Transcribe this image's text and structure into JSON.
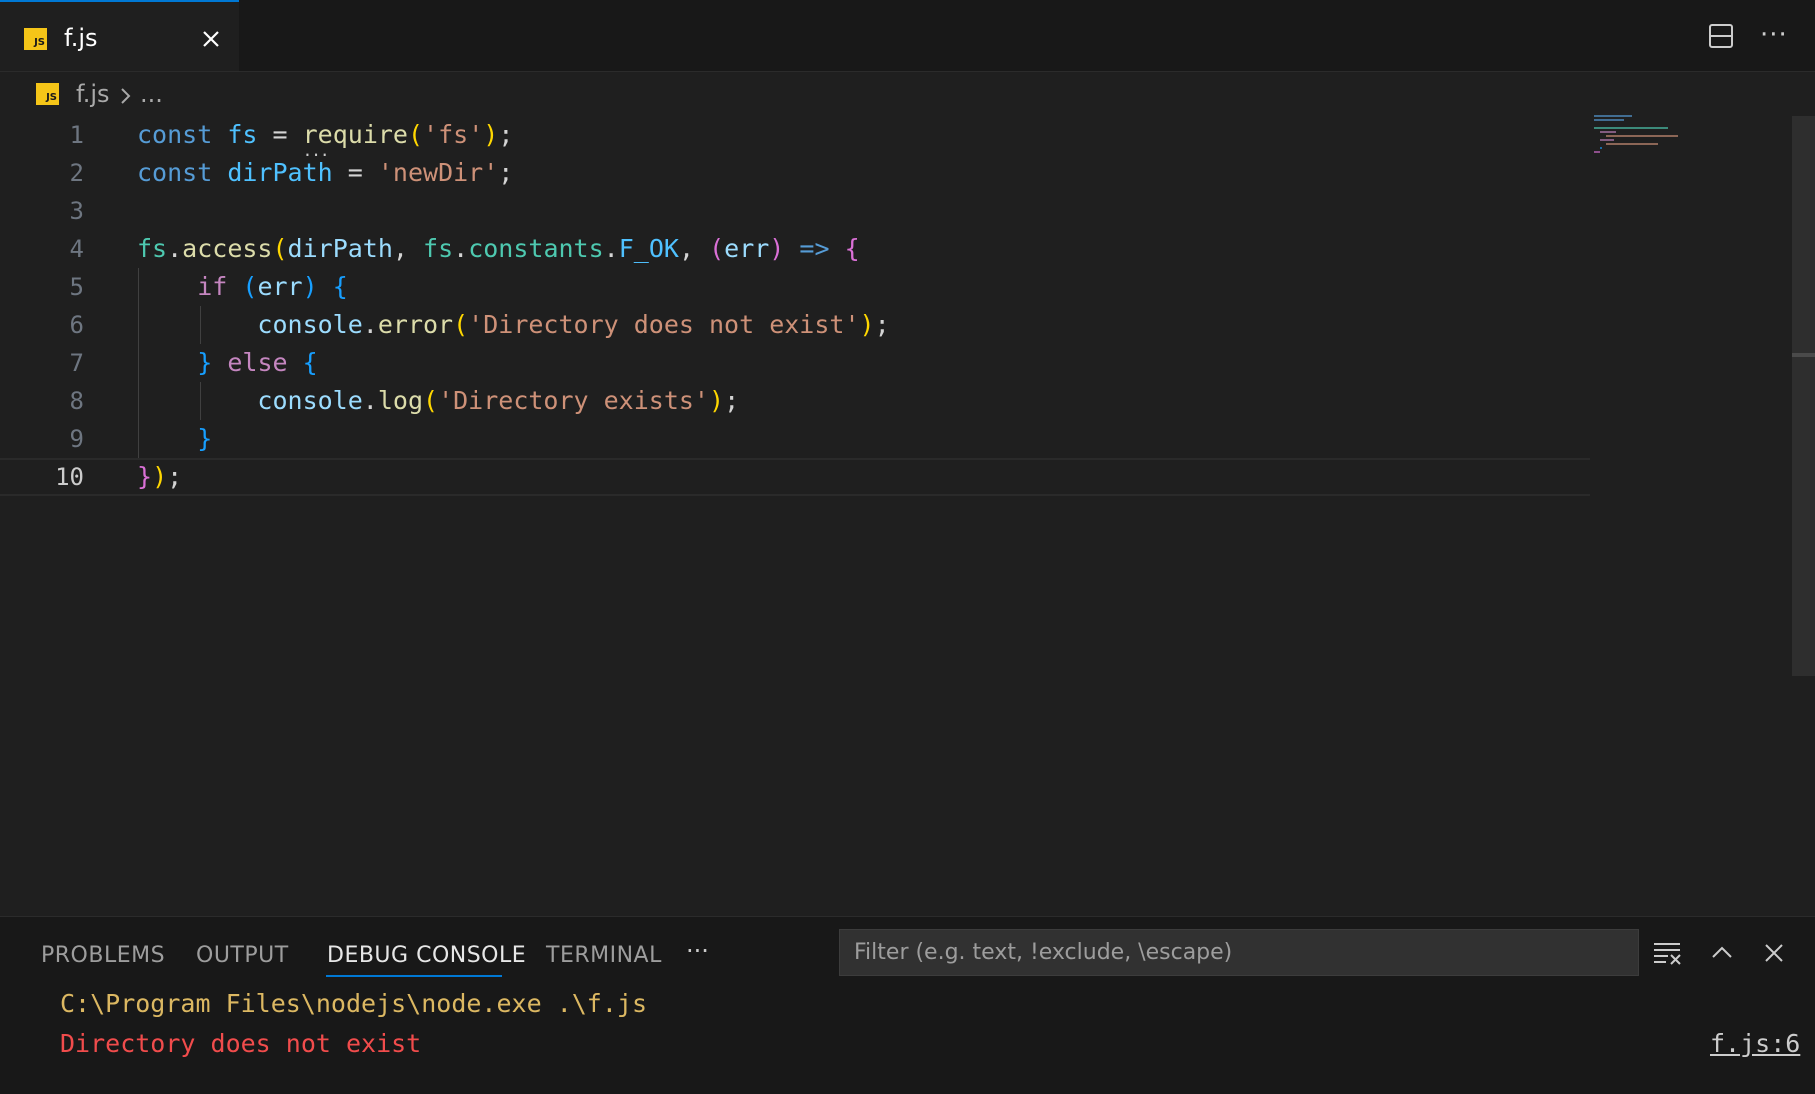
{
  "tab": {
    "filename": "f.js",
    "badge": "JS"
  },
  "breadcrumb": {
    "file": "f.js",
    "more": "..."
  },
  "editor": {
    "line_numbers": [
      "1",
      "2",
      "3",
      "4",
      "5",
      "6",
      "7",
      "8",
      "9",
      "10"
    ],
    "current_line": "10",
    "code": {
      "l1": {
        "a": "const",
        "b": "fs",
        "c": "=",
        "d": "require",
        "e": "(",
        "f": "'fs'",
        "g": ")",
        "h": ";"
      },
      "l2": {
        "a": "const",
        "b": "dirPath",
        "c": "=",
        "d": "'newDir'",
        "e": ";"
      },
      "l4": {
        "a": "fs",
        "b": ".",
        "c": "access",
        "d": "(",
        "e": "dirPath",
        "f": ",",
        "g": "fs",
        "h": ".",
        "i": "constants",
        "j": ".",
        "k": "F_OK",
        "l": ",",
        "m": "(",
        "n": "err",
        "o": ")",
        "p": "=>",
        "q": "{"
      },
      "l5": {
        "a": "if",
        "b": "(",
        "c": "err",
        "d": ")",
        "e": "{"
      },
      "l6": {
        "a": "console",
        "b": ".",
        "c": "error",
        "d": "(",
        "e": "'Directory does not exist'",
        "f": ")",
        "g": ";"
      },
      "l7": {
        "a": "}",
        "b": "else",
        "c": "{"
      },
      "l8": {
        "a": "console",
        "b": ".",
        "c": "log",
        "d": "(",
        "e": "'Directory exists'",
        "f": ")",
        "g": ";"
      },
      "l9": {
        "a": "}"
      },
      "l10": {
        "a": "}",
        "b": ")",
        "c": ";"
      }
    }
  },
  "panel": {
    "tabs": [
      "PROBLEMS",
      "OUTPUT",
      "DEBUG CONSOLE",
      "TERMINAL"
    ],
    "active_tab": "DEBUG CONSOLE",
    "more": "···",
    "filter_placeholder": "Filter (e.g. text, !exclude, \\escape)",
    "console": {
      "command": "C:\\Program Files\\nodejs\\node.exe .\\f.js",
      "error": "Directory does not exist",
      "source_link": "f.js:6"
    }
  },
  "colors": {
    "accent": "#0078d4",
    "error": "#f14c4c",
    "command": "#dcb862",
    "js_badge": "#f5c518"
  }
}
